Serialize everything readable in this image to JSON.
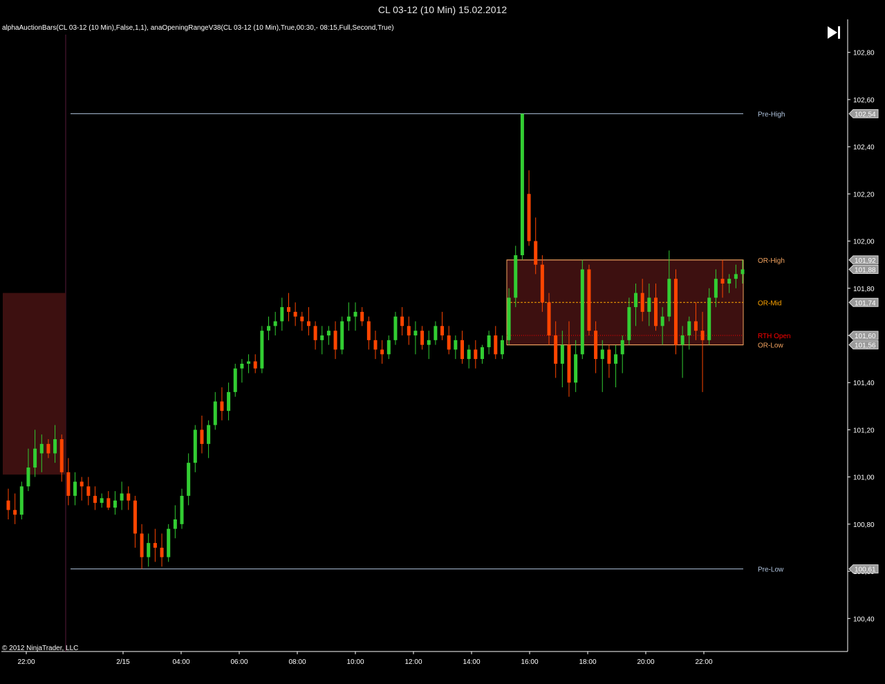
{
  "window": {
    "title": "CL 03-12 (10 Min)  15.02.2012"
  },
  "indicator_line": "alphaAuctionBars(CL 03-12 (10 Min),False,1,1), anaOpeningRangeV38(CL 03-12 (10 Min),True,00:30,- 08:15,Full,Second,True)",
  "copyright": "© 2012 NinjaTrader, LLC",
  "icons": {
    "scroll_end": "skip-to-end-icon"
  },
  "colors": {
    "background": "#000000",
    "up_body": "#32cd32",
    "down_body": "#ff4500",
    "doji": "#ffffff",
    "grid_axis": "#ffffff",
    "pre_levels": "#b0c4de",
    "or_levels": "#f4a460",
    "or_box_fill": "#3d1010",
    "or_mid": "#ffa500",
    "rth_open": "#ff0000"
  },
  "chart_data": {
    "type": "candlestick",
    "ylim": [
      100.26,
      102.94
    ],
    "y_ticks": [
      "102,80",
      "102,60",
      "102,40",
      "102,20",
      "102,00",
      "101,80",
      "101,60",
      "101,40",
      "101,20",
      "101,00",
      "100,80",
      "100,60",
      "100,40"
    ],
    "y_tick_values": [
      102.8,
      102.6,
      102.4,
      102.2,
      102.0,
      101.8,
      101.6,
      101.4,
      101.2,
      101.0,
      100.8,
      100.6,
      100.4
    ],
    "x_ticks": [
      "22:00",
      "2/15",
      "04:00",
      "06:00",
      "08:00",
      "10:00",
      "12:00",
      "14:00",
      "16:00",
      "18:00",
      "20:00",
      "22:00"
    ],
    "levels": [
      {
        "name": "Pre-High",
        "value": 102.54,
        "tag": "102,54"
      },
      {
        "name": "OR-High",
        "value": 101.92,
        "tag": "101,92"
      },
      {
        "name": "OR-Mid",
        "value": 101.74,
        "tag": "101,74"
      },
      {
        "name": "RTH Open",
        "value": 101.6,
        "tag": "101,60"
      },
      {
        "name": "OR-Low",
        "value": 101.56,
        "tag": "101,56"
      },
      {
        "name": "Pre-Low",
        "value": 100.61,
        "tag": "100,61"
      }
    ],
    "last_price_tag": "101,88",
    "last_price": 101.88,
    "opening_range": {
      "high": 101.92,
      "low": 101.56
    },
    "prev_session_range": {
      "high": 101.78,
      "low": 101.01
    },
    "candles": [
      [
        100.9,
        100.95,
        100.82,
        100.86
      ],
      [
        100.86,
        100.93,
        100.8,
        100.84
      ],
      [
        100.84,
        100.98,
        100.82,
        100.96
      ],
      [
        100.96,
        101.12,
        100.94,
        101.04
      ],
      [
        101.04,
        101.2,
        101.0,
        101.12
      ],
      [
        101.1,
        101.18,
        101.02,
        101.14
      ],
      [
        101.14,
        101.16,
        101.08,
        101.1
      ],
      [
        101.1,
        101.22,
        101.06,
        101.16
      ],
      [
        101.16,
        101.18,
        100.98,
        101.02
      ],
      [
        101.02,
        101.08,
        100.88,
        100.92
      ],
      [
        100.92,
        101.02,
        100.88,
        100.98
      ],
      [
        100.98,
        101.0,
        100.9,
        100.96
      ],
      [
        100.96,
        101.0,
        100.88,
        100.92
      ],
      [
        100.92,
        100.96,
        100.86,
        100.89
      ],
      [
        100.89,
        100.93,
        100.87,
        100.91
      ],
      [
        100.91,
        100.94,
        100.86,
        100.87
      ],
      [
        100.87,
        100.94,
        100.84,
        100.9
      ],
      [
        100.9,
        100.98,
        100.86,
        100.93
      ],
      [
        100.93,
        100.96,
        100.86,
        100.9
      ],
      [
        100.9,
        100.92,
        100.7,
        100.76
      ],
      [
        100.76,
        100.8,
        100.61,
        100.66
      ],
      [
        100.66,
        100.76,
        100.62,
        100.72
      ],
      [
        100.72,
        100.78,
        100.64,
        100.7
      ],
      [
        100.7,
        100.76,
        100.62,
        100.66
      ],
      [
        100.66,
        100.8,
        100.64,
        100.78
      ],
      [
        100.78,
        100.88,
        100.74,
        100.82
      ],
      [
        100.8,
        100.95,
        100.78,
        100.92
      ],
      [
        100.92,
        101.1,
        100.88,
        101.06
      ],
      [
        101.06,
        101.22,
        101.02,
        101.2
      ],
      [
        101.2,
        101.26,
        101.1,
        101.14
      ],
      [
        101.14,
        101.24,
        101.08,
        101.22
      ],
      [
        101.22,
        101.36,
        101.2,
        101.32
      ],
      [
        101.32,
        101.38,
        101.24,
        101.28
      ],
      [
        101.28,
        101.4,
        101.24,
        101.36
      ],
      [
        101.36,
        101.48,
        101.34,
        101.46
      ],
      [
        101.46,
        101.5,
        101.4,
        101.48
      ],
      [
        101.48,
        101.52,
        101.44,
        101.49
      ],
      [
        101.49,
        101.52,
        101.44,
        101.46
      ],
      [
        101.46,
        101.64,
        101.44,
        101.62
      ],
      [
        101.62,
        101.68,
        101.58,
        101.64
      ],
      [
        101.64,
        101.7,
        101.6,
        101.66
      ],
      [
        101.66,
        101.76,
        101.62,
        101.72
      ],
      [
        101.72,
        101.78,
        101.66,
        101.7
      ],
      [
        101.7,
        101.74,
        101.64,
        101.68
      ],
      [
        101.68,
        101.7,
        101.62,
        101.66
      ],
      [
        101.66,
        101.72,
        101.6,
        101.64
      ],
      [
        101.64,
        101.66,
        101.54,
        101.58
      ],
      [
        101.58,
        101.64,
        101.52,
        101.6
      ],
      [
        101.6,
        101.64,
        101.56,
        101.62
      ],
      [
        101.62,
        101.66,
        101.5,
        101.54
      ],
      [
        101.54,
        101.68,
        101.52,
        101.66
      ],
      [
        101.66,
        101.74,
        101.62,
        101.68
      ],
      [
        101.68,
        101.74,
        101.62,
        101.7
      ],
      [
        101.7,
        101.72,
        101.64,
        101.66
      ],
      [
        101.66,
        101.68,
        101.54,
        101.58
      ],
      [
        101.58,
        101.62,
        101.5,
        101.54
      ],
      [
        101.54,
        101.58,
        101.48,
        101.52
      ],
      [
        101.52,
        101.6,
        101.5,
        101.58
      ],
      [
        101.58,
        101.7,
        101.56,
        101.68
      ],
      [
        101.68,
        101.72,
        101.6,
        101.64
      ],
      [
        101.64,
        101.68,
        101.56,
        101.6
      ],
      [
        101.6,
        101.66,
        101.52,
        101.62
      ],
      [
        101.62,
        101.64,
        101.54,
        101.56
      ],
      [
        101.56,
        101.62,
        101.5,
        101.58
      ],
      [
        101.58,
        101.66,
        101.56,
        101.64
      ],
      [
        101.64,
        101.7,
        101.58,
        101.6
      ],
      [
        101.6,
        101.64,
        101.52,
        101.54
      ],
      [
        101.54,
        101.6,
        101.5,
        101.58
      ],
      [
        101.58,
        101.62,
        101.48,
        101.5
      ],
      [
        101.5,
        101.56,
        101.46,
        101.54
      ],
      [
        101.54,
        101.58,
        101.46,
        101.5
      ],
      [
        101.5,
        101.56,
        101.48,
        101.55
      ],
      [
        101.55,
        101.62,
        101.52,
        101.6
      ],
      [
        101.6,
        101.64,
        101.5,
        101.52
      ],
      [
        101.52,
        101.6,
        101.5,
        101.58
      ],
      [
        101.58,
        101.8,
        101.56,
        101.76
      ],
      [
        101.76,
        101.98,
        101.72,
        101.94
      ],
      [
        101.94,
        102.28,
        101.92,
        102.54
      ],
      [
        102.2,
        102.3,
        101.98,
        102.0
      ],
      [
        102.0,
        102.1,
        101.86,
        101.9
      ],
      [
        101.9,
        101.94,
        101.7,
        101.74
      ],
      [
        101.74,
        101.78,
        101.56,
        101.6
      ],
      [
        101.6,
        101.66,
        101.42,
        101.48
      ],
      [
        101.48,
        101.62,
        101.38,
        101.56
      ],
      [
        101.56,
        101.66,
        101.34,
        101.4
      ],
      [
        101.4,
        101.58,
        101.36,
        101.52
      ],
      [
        101.52,
        101.92,
        101.5,
        101.88
      ],
      [
        101.88,
        101.9,
        101.6,
        101.62
      ],
      [
        101.62,
        101.66,
        101.44,
        101.5
      ],
      [
        101.5,
        101.58,
        101.36,
        101.54
      ],
      [
        101.54,
        101.56,
        101.42,
        101.48
      ],
      [
        101.48,
        101.56,
        101.38,
        101.52
      ],
      [
        101.52,
        101.6,
        101.44,
        101.58
      ],
      [
        101.58,
        101.76,
        101.56,
        101.72
      ],
      [
        101.72,
        101.82,
        101.64,
        101.78
      ],
      [
        101.78,
        101.84,
        101.66,
        101.7
      ],
      [
        101.7,
        101.82,
        101.64,
        101.76
      ],
      [
        101.76,
        101.82,
        101.62,
        101.64
      ],
      [
        101.64,
        101.72,
        101.56,
        101.68
      ],
      [
        101.68,
        101.96,
        101.66,
        101.84
      ],
      [
        101.84,
        101.88,
        101.52,
        101.56
      ],
      [
        101.56,
        101.64,
        101.42,
        101.6
      ],
      [
        101.6,
        101.68,
        101.54,
        101.66
      ],
      [
        101.66,
        101.74,
        101.58,
        101.62
      ],
      [
        101.62,
        101.7,
        101.36,
        101.58
      ],
      [
        101.58,
        101.8,
        101.56,
        101.76
      ],
      [
        101.76,
        101.88,
        101.72,
        101.84
      ],
      [
        101.84,
        101.92,
        101.76,
        101.82
      ],
      [
        101.82,
        101.86,
        101.78,
        101.84
      ],
      [
        101.84,
        101.9,
        101.8,
        101.86
      ],
      [
        101.86,
        101.92,
        101.82,
        101.88
      ]
    ]
  }
}
